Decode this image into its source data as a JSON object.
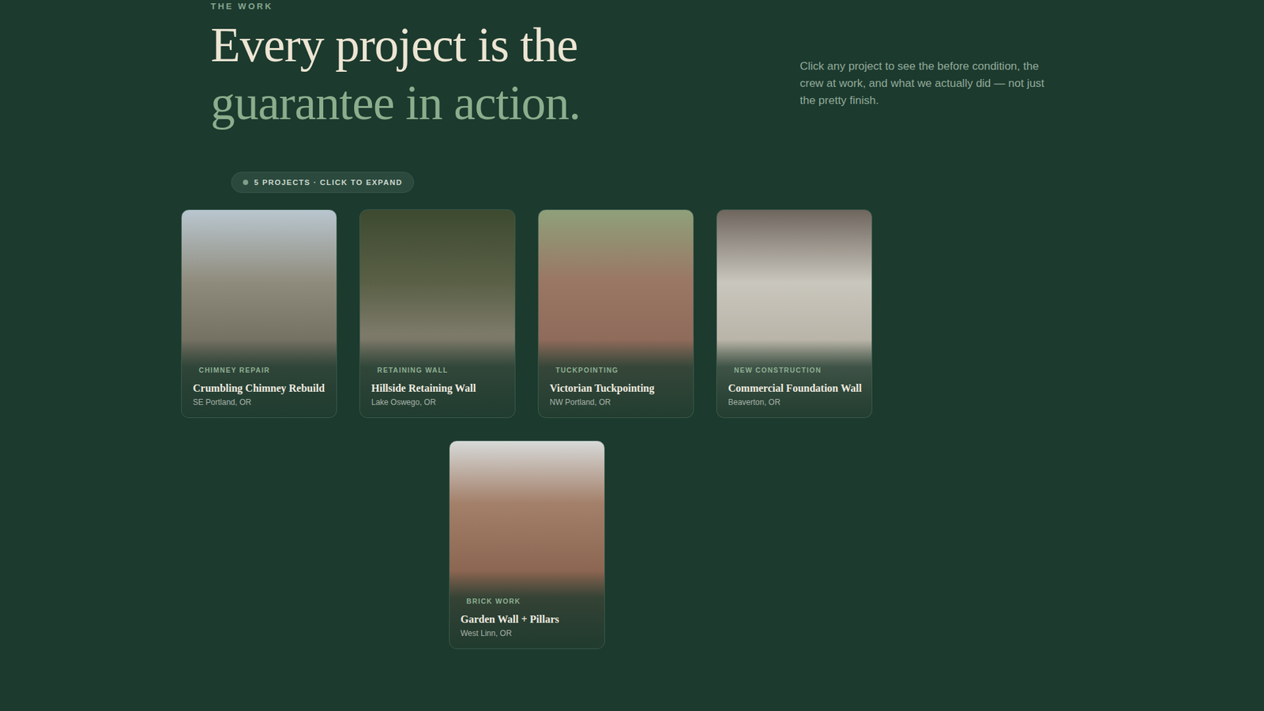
{
  "section": {
    "eyebrow": "THE WORK",
    "heading_line1": "Every project is the",
    "heading_line2": "guarantee in action.",
    "description": "Click any project to see the before condition, the crew at work, and what we actually did — not just the pretty finish."
  },
  "badge": {
    "label": "5 PROJECTS · CLICK TO EXPAND"
  },
  "projects": [
    {
      "category": "CHIMNEY REPAIR",
      "title": "Crumbling Chimney Rebuild",
      "location": "SE Portland, OR"
    },
    {
      "category": "RETAINING WALL",
      "title": "Hillside Retaining Wall",
      "location": "Lake Oswego, OR"
    },
    {
      "category": "TUCKPOINTING",
      "title": "Victorian Tuckpointing",
      "location": "NW Portland, OR"
    },
    {
      "category": "NEW CONSTRUCTION",
      "title": "Commercial Foundation Wall",
      "location": "Beaverton, OR"
    },
    {
      "category": "BRICK WORK",
      "title": "Garden Wall + Pillars",
      "location": "West Linn, OR"
    }
  ]
}
